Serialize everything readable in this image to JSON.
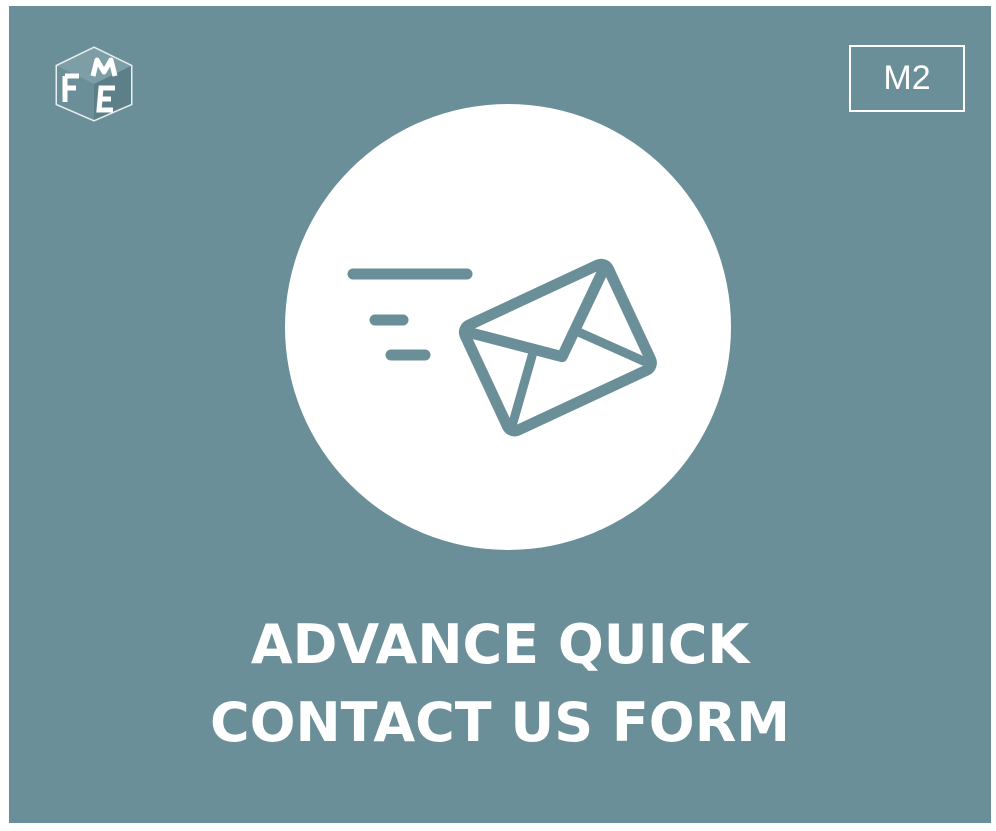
{
  "logo": {
    "letters": "FME",
    "icon": "fme-logo-cube"
  },
  "badge": {
    "label": "M2"
  },
  "hero": {
    "icon": "fast-mail-envelope-icon"
  },
  "title": {
    "line1": "ADVANCE QUICK",
    "line2": "CONTACT US FORM"
  },
  "colors": {
    "background": "#6b8f98",
    "circle": "#ffffff",
    "text": "#ffffff",
    "icon_stroke": "#6b8f98"
  }
}
